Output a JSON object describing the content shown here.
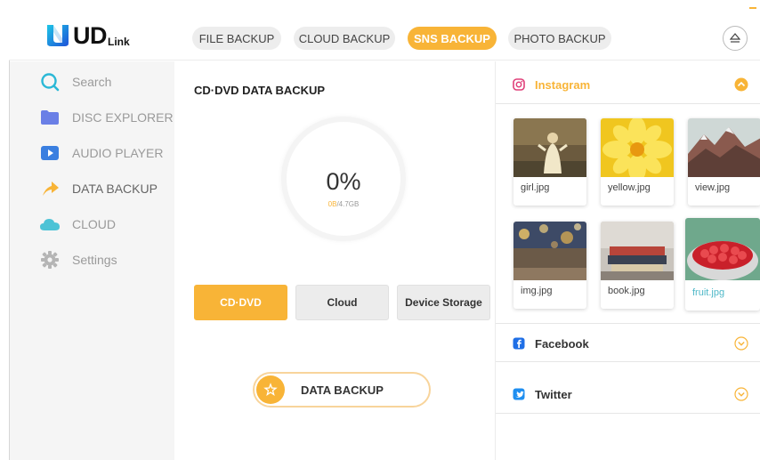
{
  "app": {
    "logo_main": "UD",
    "logo_sub": "Link"
  },
  "tabs": [
    {
      "label": "FILE BACKUP",
      "active": false
    },
    {
      "label": "CLOUD BACKUP",
      "active": false
    },
    {
      "label": "SNS BACKUP",
      "active": true
    },
    {
      "label": "PHOTO BACKUP",
      "active": false
    }
  ],
  "sidebar": {
    "items": [
      {
        "label": "Search",
        "icon": "search-icon"
      },
      {
        "label": "DISC EXPLORER",
        "icon": "folder-icon"
      },
      {
        "label": "AUDIO PLAYER",
        "icon": "play-icon"
      },
      {
        "label": "DATA BACKUP",
        "icon": "backup-arrow-icon",
        "active": true
      },
      {
        "label": "CLOUD",
        "icon": "cloud-icon"
      },
      {
        "label": "Settings",
        "icon": "gear-icon"
      }
    ]
  },
  "center": {
    "title": "CD·DVD  DATA BACKUP",
    "percent": "0%",
    "used": "0B",
    "total": "/4.7GB",
    "options": [
      {
        "label": "CD·DVD",
        "active": true
      },
      {
        "label": "Cloud",
        "active": false
      },
      {
        "label": "Device Storage",
        "active": false
      }
    ],
    "backup_button": "DATA BACKUP"
  },
  "sns": {
    "instagram": {
      "label": "Instagram",
      "expanded": true
    },
    "photos": [
      {
        "name": "girl.jpg"
      },
      {
        "name": "yellow.jpg"
      },
      {
        "name": "view.jpg"
      },
      {
        "name": "img.jpg"
      },
      {
        "name": "book.jpg"
      },
      {
        "name": "fruit.jpg",
        "selected": true
      }
    ],
    "facebook": {
      "label": "Facebook"
    },
    "twitter": {
      "label": "Twitter"
    }
  },
  "colors": {
    "accent": "#f8b437",
    "logo_blue": "#1e62e0",
    "logo_cyan": "#1ec6e6",
    "selected_text": "#4fb8c8"
  }
}
